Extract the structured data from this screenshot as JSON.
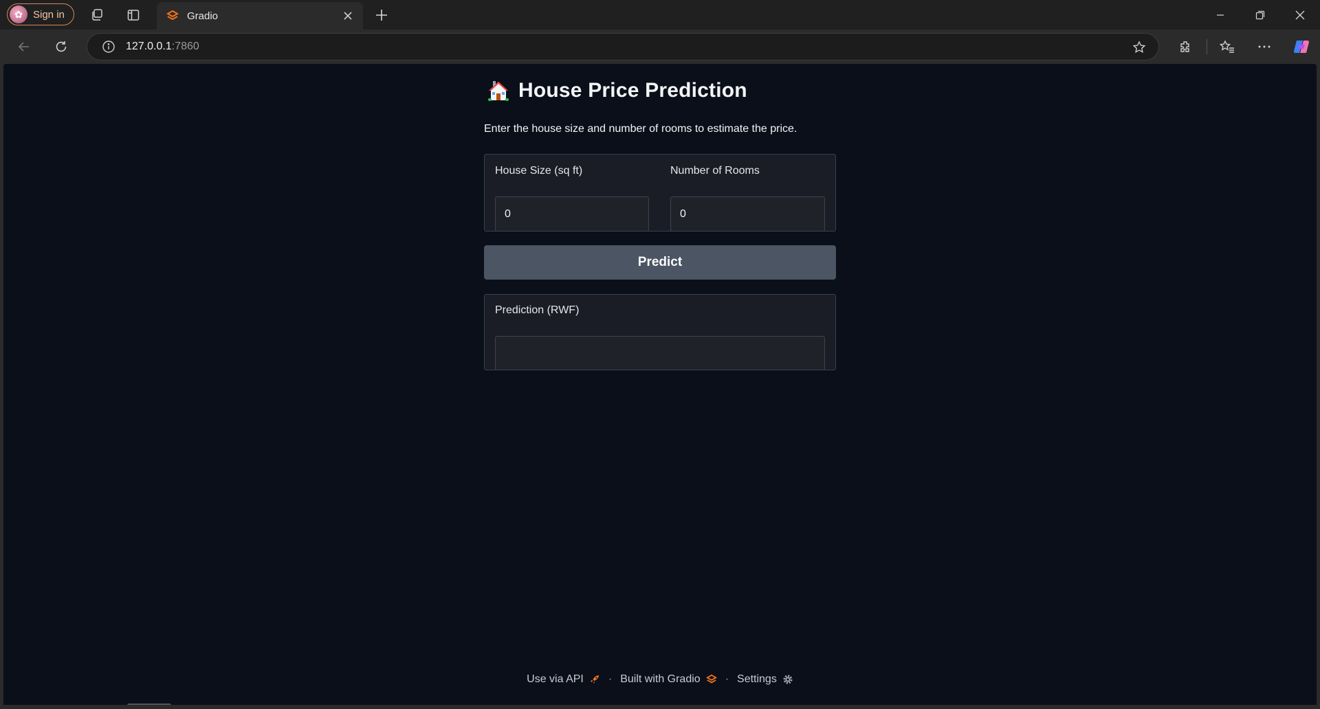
{
  "browser": {
    "signin_label": "Sign in",
    "tab_title": "Gradio",
    "url_host": "127.0.0.1",
    "url_port": ":7860"
  },
  "app": {
    "title": "House Price Prediction",
    "description": "Enter the house size and number of rooms to estimate the price.",
    "house_size": {
      "label": "House Size (sq ft)",
      "value": "0"
    },
    "rooms": {
      "label": "Number of Rooms",
      "value": "0"
    },
    "predict_label": "Predict",
    "output": {
      "label": "Prediction (RWF)",
      "value": ""
    }
  },
  "footer": {
    "api_label": "Use via API",
    "built_label": "Built with Gradio",
    "settings_label": "Settings",
    "separator": "·"
  },
  "colors": {
    "page_bg": "#0b0f19",
    "button_bg": "#4b5563",
    "gradio_orange": "#f97316"
  }
}
